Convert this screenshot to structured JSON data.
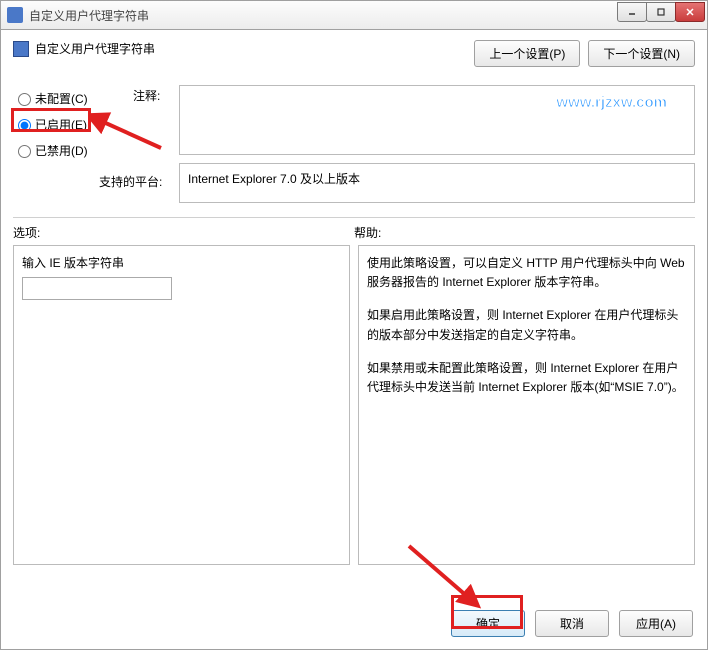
{
  "window": {
    "title": "自定义用户代理字符串"
  },
  "header": {
    "title": "自定义用户代理字符串",
    "prev_btn": "上一个设置(P)",
    "next_btn": "下一个设置(N)"
  },
  "watermark": "www.rjzxw.com",
  "radios": {
    "not_configured": "未配置(C)",
    "enabled": "已启用(E)",
    "disabled": "已禁用(D)"
  },
  "labels": {
    "comment": "注释:",
    "platform": "支持的平台:",
    "options": "选项:",
    "help": "帮助:"
  },
  "platform_text": "Internet Explorer 7.0 及以上版本",
  "options_panel": {
    "input_label": "输入 IE 版本字符串",
    "input_value": ""
  },
  "help_panel": {
    "p1": "使用此策略设置，可以自定义 HTTP 用户代理标头中向 Web 服务器报告的 Internet Explorer 版本字符串。",
    "p2": "如果启用此策略设置，则 Internet Explorer 在用户代理标头的版本部分中发送指定的自定义字符串。",
    "p3": "如果禁用或未配置此策略设置，则 Internet Explorer 在用户代理标头中发送当前 Internet Explorer 版本(如“MSIE 7.0”)。"
  },
  "footer": {
    "ok": "确定",
    "cancel": "取消",
    "apply": "应用(A)"
  }
}
